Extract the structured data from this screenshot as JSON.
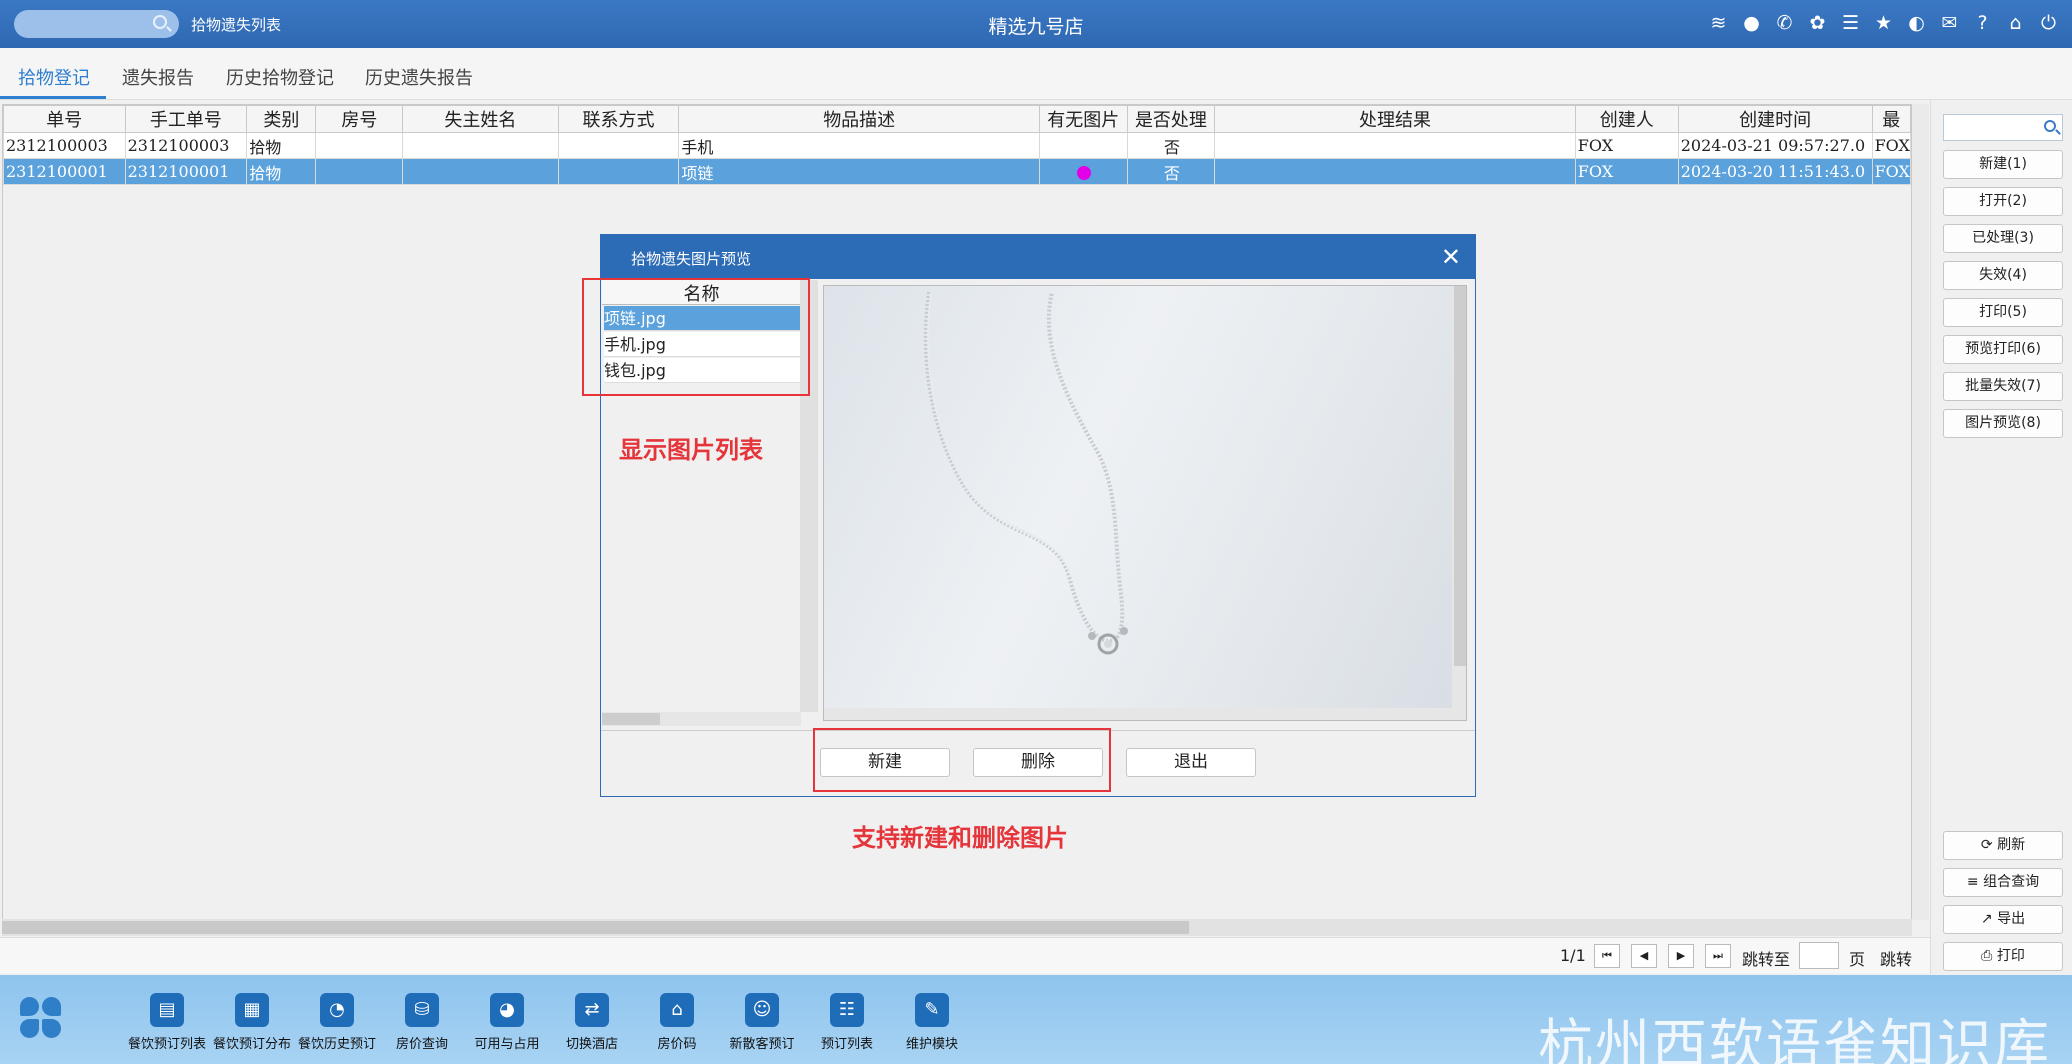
{
  "topbar": {
    "title_left": "拾物遗失列表",
    "title_center": "精选九号店",
    "icons": [
      "wifi-icon",
      "chat-icon",
      "phone-icon",
      "palette-icon",
      "menu-icon",
      "star-icon",
      "theme-icon",
      "mail-icon",
      "help-icon",
      "home-icon",
      "power-icon"
    ]
  },
  "tabs": [
    "拾物登记",
    "遗失报告",
    "历史拾物登记",
    "历史遗失报告"
  ],
  "grid": {
    "columns": [
      "单号",
      "手工单号",
      "类别",
      "房号",
      "失主姓名",
      "联系方式",
      "物品描述",
      "有无图片",
      "是否处理",
      "处理结果",
      "创建人",
      "创建时间",
      "最"
    ],
    "rows": [
      {
        "no": "2312100003",
        "manual_no": "2312100003",
        "type": "拾物",
        "room": "",
        "owner": "",
        "contact": "",
        "desc": "手机",
        "has_image": false,
        "handled": "否",
        "result": "",
        "creator": "FOX",
        "created": "2024-03-21 09:57:27.0",
        "last": "FOX"
      },
      {
        "no": "2312100001",
        "manual_no": "2312100001",
        "type": "拾物",
        "room": "",
        "owner": "",
        "contact": "",
        "desc": "项链",
        "has_image": true,
        "handled": "否",
        "result": "",
        "creator": "FOX",
        "created": "2024-03-20 11:51:43.0",
        "last": "FOX"
      }
    ],
    "selected_row": 1
  },
  "pager": {
    "page": "1/1",
    "jump_to": "跳转至",
    "page_unit": "页",
    "jump": "跳转"
  },
  "rightpanel": {
    "buttons": [
      "新建(1)",
      "打开(2)",
      "已处理(3)",
      "失效(4)",
      "打印(5)",
      "预览打印(6)",
      "批量失效(7)",
      "图片预览(8)"
    ],
    "bottom_buttons": [
      "刷新",
      "组合查询",
      "导出",
      "打印"
    ]
  },
  "dialog": {
    "title": "拾物遗失图片预览",
    "list_header": "名称",
    "files": [
      "项链.jpg",
      "手机.jpg",
      "钱包.jpg"
    ],
    "selected_file": 0,
    "buttons": {
      "new": "新建",
      "delete": "删除",
      "exit": "退出"
    }
  },
  "annotations": {
    "list_note": "显示图片列表",
    "button_note": "支持新建和删除图片"
  },
  "bottombar": {
    "items": [
      {
        "label": "餐饮预订列表",
        "icon": "clipboard-icon"
      },
      {
        "label": "餐饮预订分布",
        "icon": "building-icon"
      },
      {
        "label": "餐饮历史预订",
        "icon": "clock-icon"
      },
      {
        "label": "房价查询",
        "icon": "coins-icon"
      },
      {
        "label": "可用与占用",
        "icon": "pie-icon"
      },
      {
        "label": "切换酒店",
        "icon": "swap-icon"
      },
      {
        "label": "房价码",
        "icon": "house-icon"
      },
      {
        "label": "新散客预订",
        "icon": "person-add-icon"
      },
      {
        "label": "预订列表",
        "icon": "list-icon"
      },
      {
        "label": "维护模块",
        "icon": "wrench-icon"
      }
    ],
    "watermark": "杭州西软语雀知识库"
  }
}
